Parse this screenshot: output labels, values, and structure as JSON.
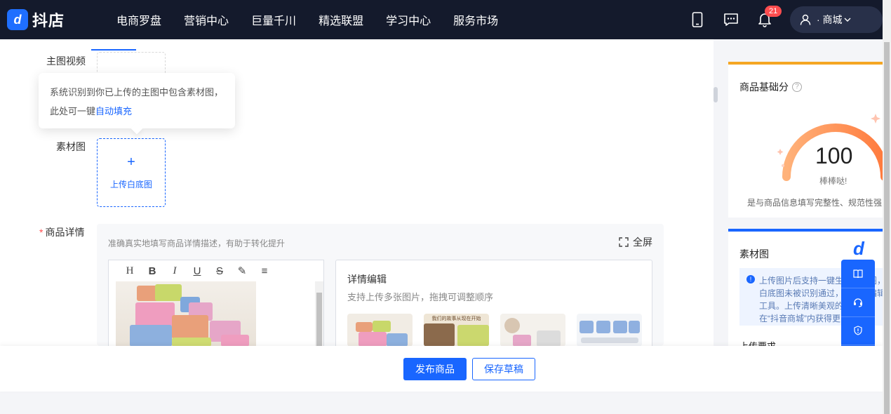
{
  "header": {
    "logo_mark": "d",
    "logo_text": "抖店",
    "nav": [
      "电商罗盘",
      "营销中心",
      "巨量千川",
      "精选联盟",
      "学习中心",
      "服务市场"
    ],
    "notification_count": "21",
    "user_name": "· 商城"
  },
  "form": {
    "main_video_label": "主图视频",
    "tooltip_text": "系统识别到你已上传的主图中包含素材图，此处可一键",
    "tooltip_link": "自动填充",
    "material_label": "素材图",
    "upload_plus": "+",
    "upload_white_bg": "上传白底图",
    "detail_required_mark": "*",
    "detail_label": "商品详情",
    "detail_hint": "准确真实地填写商品详情描述，有助于转化提升",
    "fullscreen_label": "全屏",
    "toolbar": [
      "H",
      "B",
      "I",
      "U",
      "S",
      "✎",
      "≡"
    ],
    "detail_edit_title": "详情编辑",
    "detail_edit_sub": "支持上传多张图片，拖拽可调整顺序",
    "thumb_caption": "我们的故事从现在开始"
  },
  "score_panel": {
    "title": "商品基础分",
    "help": "?",
    "score": "100",
    "score_sub": "棒棒哒!",
    "desc": "是与商品信息填写完整性、规范性强"
  },
  "material_panel": {
    "title": "素材图",
    "info_icon": "!",
    "info_text": "上传图片后支持一键生成素材图，白底图未被识别通过，可使用编辑工具。上传清晰美观的素材图，在“抖音商城”内获得更多曝光",
    "upload_req": "上传要求"
  },
  "float_helper": {
    "logo": "d",
    "items": [
      "book-icon",
      "headset-icon",
      "shield-icon",
      "mail-icon"
    ]
  },
  "bottom": {
    "publish": "发布商品",
    "save_draft": "保存草稿"
  },
  "colors": {
    "nav_bg": "#141a2c",
    "primary": "#1966ff",
    "score_accent": "#f5a623"
  }
}
